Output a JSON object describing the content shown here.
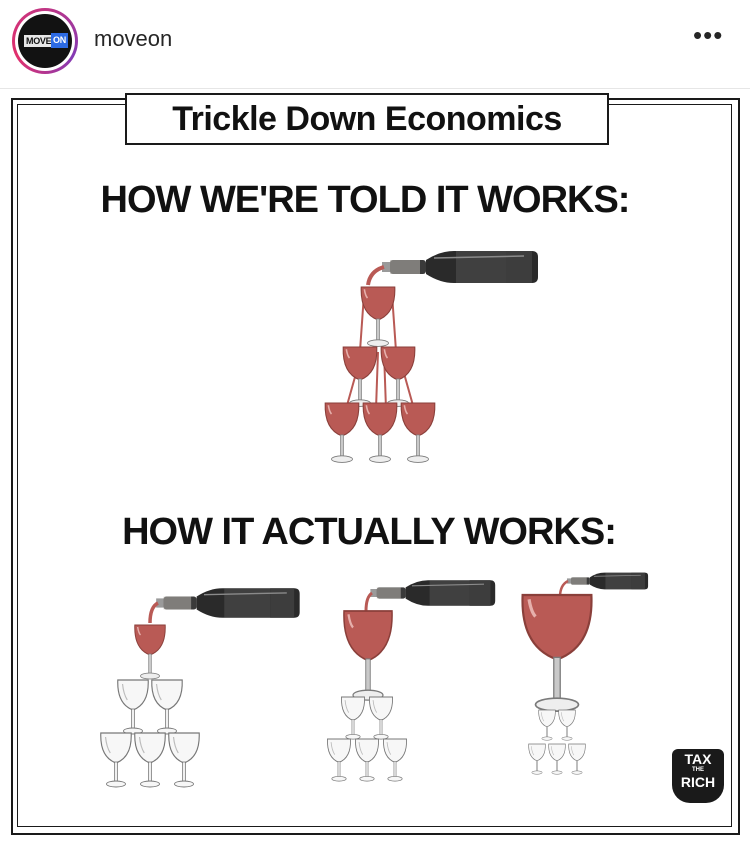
{
  "header": {
    "username": "moveon",
    "more_label": "•••",
    "avatar_logo": {
      "part1": "MOVE",
      "part2": "ON",
      "bg": "#121212",
      "accent": "#2d6be4"
    }
  },
  "post": {
    "title": "Trickle Down Economics",
    "heading_told": "HOW WE'RE TOLD IT WORKS:",
    "heading_actual": "HOW IT ACTUALLY WORKS:",
    "badge": {
      "line1": "TAX",
      "line2": "THE",
      "line3": "RICH"
    },
    "colors": {
      "wine": "#b95a55",
      "bottle": "#2a2a2a",
      "glass_outline": "#7a7a7a",
      "frame": "#1a1a1a"
    }
  }
}
